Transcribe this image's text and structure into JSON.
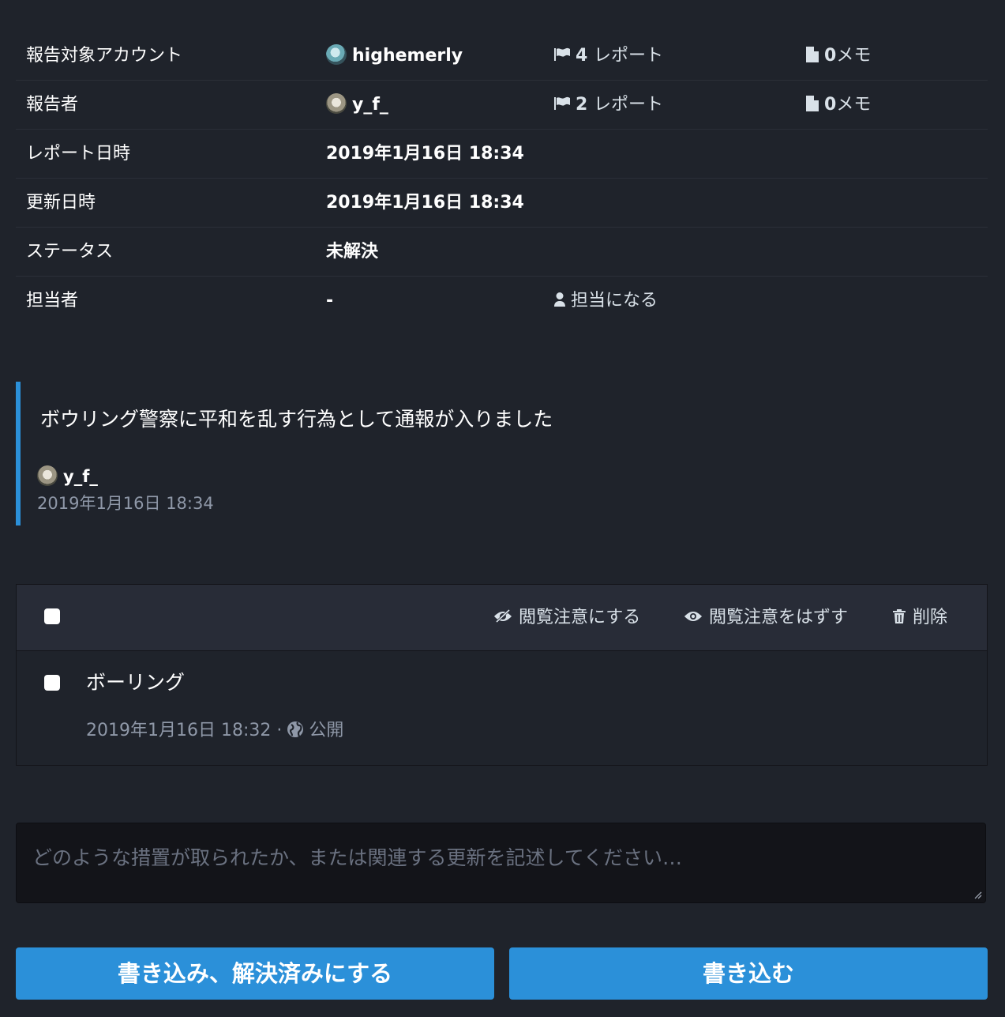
{
  "info": {
    "target_account": {
      "label": "報告対象アカウント",
      "avatar_icon": "avatar-teal-icon",
      "username": "highemerly",
      "reports_count": "4",
      "reports_label": "レポート",
      "notes_count": "0",
      "notes_label": "メモ"
    },
    "reporter": {
      "label": "報告者",
      "avatar_icon": "avatar-photo-icon",
      "username": "y_f_",
      "reports_count": "2",
      "reports_label": "レポート",
      "notes_count": "0",
      "notes_label": "メモ"
    },
    "reported_at": {
      "label": "レポート日時",
      "value": "2019年1月16日 18:34"
    },
    "updated_at": {
      "label": "更新日時",
      "value": "2019年1月16日 18:34"
    },
    "status": {
      "label": "ステータス",
      "value": "未解決"
    },
    "assignee": {
      "label": "担当者",
      "value": "-",
      "assign_label": "担当になる"
    }
  },
  "report_comment": {
    "text": "ボウリング警察に平和を乱す行為として通報が入りました",
    "author": "y_f_",
    "date": "2019年1月16日 18:34"
  },
  "statuses": {
    "actions": {
      "mark_sensitive": "閲覧注意にする",
      "unmark_sensitive": "閲覧注意をはずす",
      "delete": "削除"
    },
    "items": [
      {
        "content": "ボーリング",
        "date": "2019年1月16日 18:32",
        "separator": "·",
        "visibility": "公開",
        "visibility_icon": "globe-icon"
      }
    ]
  },
  "comment_form": {
    "placeholder": "どのような措置が取られたか、または関連する更新を記述してください…"
  },
  "buttons": {
    "resolve": "書き込み、解決済みにする",
    "submit": "書き込む"
  },
  "colors": {
    "background": "#1f232b",
    "panel_header": "#282c37",
    "accent": "#2b90d9",
    "muted_text": "#8f98a8",
    "input_bg": "#131419"
  }
}
